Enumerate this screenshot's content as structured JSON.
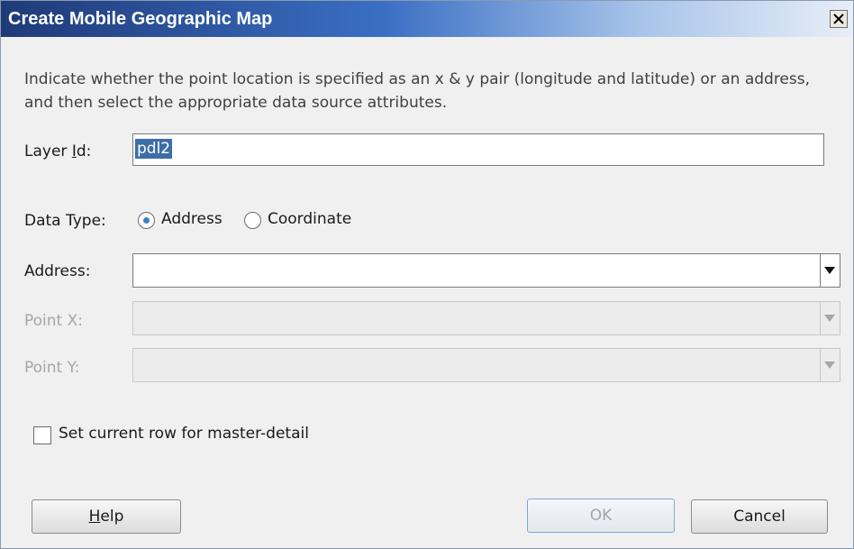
{
  "dialog": {
    "title": "Create Mobile Geographic Map",
    "close_glyph": "X",
    "description": "Indicate whether the point location is specified as an x & y pair (longitude and latitude) or an address, and then select the appropriate data source attributes."
  },
  "layer_id": {
    "label_pre": "Layer ",
    "label_mnemonic": "I",
    "label_post": "d:",
    "value": "pdl2"
  },
  "data_type": {
    "label": "Data Type:",
    "options": [
      {
        "label": "Address",
        "selected": true
      },
      {
        "label": "Coordinate",
        "selected": false
      }
    ]
  },
  "address": {
    "label": "Address:",
    "value": ""
  },
  "point_x": {
    "label": "Point X:",
    "value": "",
    "enabled": false
  },
  "point_y": {
    "label": "Point Y:",
    "value": "",
    "enabled": false
  },
  "master_detail": {
    "label": "Set current row for master-detail",
    "checked": false
  },
  "buttons": {
    "help_mnemonic": "H",
    "help_rest": "elp",
    "ok": "OK",
    "cancel": "Cancel"
  },
  "icons": {
    "close": "close-icon",
    "dropdown": "chevron-down-icon"
  },
  "colors": {
    "title_gradient_start": "#1f3a78",
    "selection": "#3c6ea8",
    "radio_dot": "#3a7fd0"
  }
}
